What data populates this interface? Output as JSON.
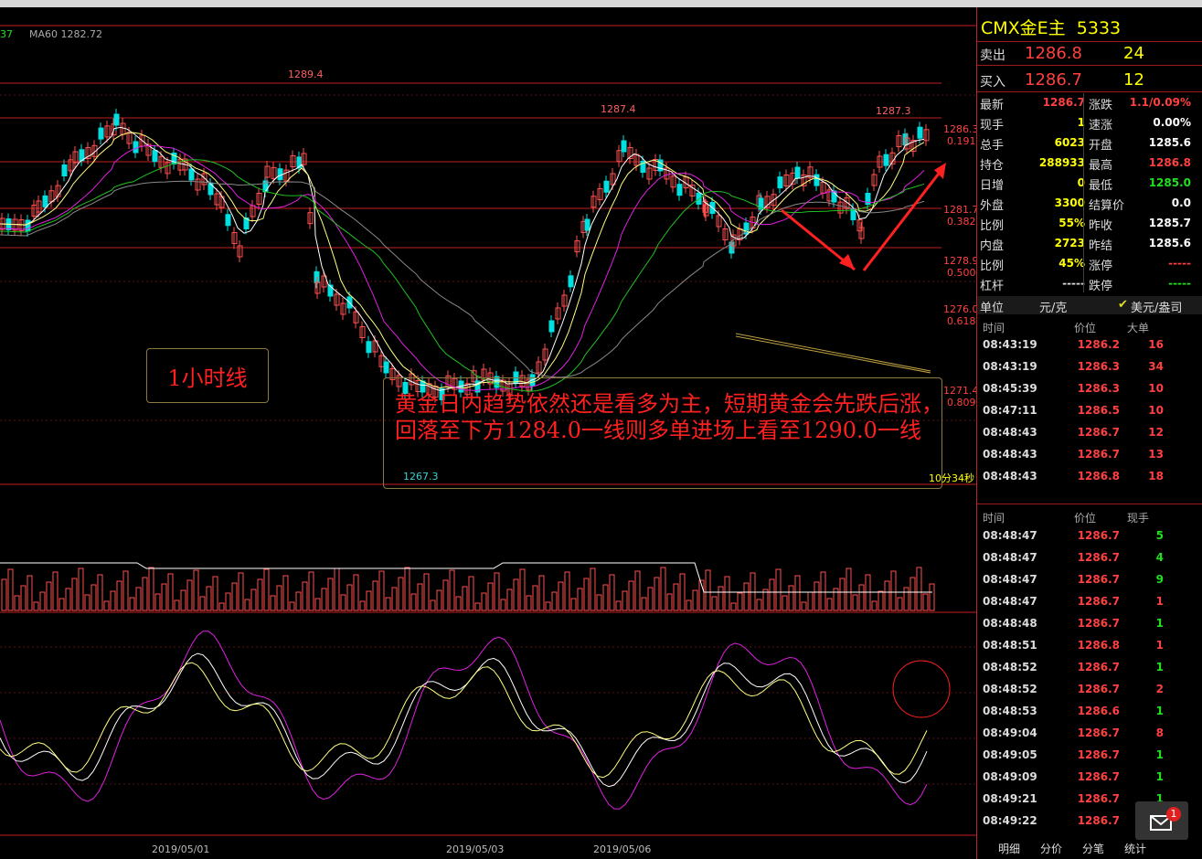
{
  "chart": {
    "ma_partial": "37",
    "ma60_label": "MA60 1282.72",
    "high_label_1": "1289.4",
    "high_label_2": "1287.4",
    "high_label_3": "1287.3",
    "low_label": "1267.3",
    "timer": "10分34秒",
    "hour_label": "1小时线",
    "annotation": "黄金日内趋势依然还是看多为主，短期黄金会先跌后涨，回落至下方1284.0一线则多单进场上看至1290.0一线",
    "fib_levels": [
      {
        "price": "1286.3",
        "ratio": "0.191"
      },
      {
        "price": "1281.7",
        "ratio": "0.382"
      },
      {
        "price": "1278.9",
        "ratio": "0.500"
      },
      {
        "price": "1276.0",
        "ratio": "0.618"
      },
      {
        "price": "1271.4",
        "ratio": "0.809"
      }
    ],
    "dates": [
      "2019/05/01",
      "2019/05/03",
      "2019/05/06"
    ]
  },
  "panel": {
    "title": "CMX金E主",
    "code": "5333",
    "sell": {
      "label": "卖出",
      "price": "1286.8",
      "qty": "24"
    },
    "buy": {
      "label": "买入",
      "price": "1286.7",
      "qty": "12"
    },
    "quote_left": [
      {
        "label": "最新",
        "value": "1286.7",
        "color": "#ff4040"
      },
      {
        "label": "现手",
        "value": "1",
        "color": "#ffff00"
      },
      {
        "label": "总手",
        "value": "6023",
        "color": "#ffff00"
      },
      {
        "label": "持仓",
        "value": "288933",
        "color": "#ffff00"
      },
      {
        "label": "日增",
        "value": "0",
        "color": "#ffff00"
      },
      {
        "label": "外盘",
        "value": "3300",
        "color": "#ffff00"
      },
      {
        "label": "比例",
        "value": "55%",
        "color": "#ffff00"
      },
      {
        "label": "内盘",
        "value": "2723",
        "color": "#ffff00"
      },
      {
        "label": "比例",
        "value": "45%",
        "color": "#ffff00"
      },
      {
        "label": "杠杆",
        "value": "-----",
        "color": "#dddddd"
      }
    ],
    "quote_right": [
      {
        "label": "涨跌",
        "value": "1.1/0.09%",
        "color": "#ff4040"
      },
      {
        "label": "速涨",
        "value": "0.00%",
        "color": "#ffffff"
      },
      {
        "label": "开盘",
        "value": "1285.6",
        "color": "#ffffff"
      },
      {
        "label": "最高",
        "value": "1286.8",
        "color": "#ff4040"
      },
      {
        "label": "最低",
        "value": "1285.0",
        "color": "#20e020"
      },
      {
        "label": "结算价",
        "value": "0.0",
        "color": "#ffffff"
      },
      {
        "label": "昨收",
        "value": "1285.7",
        "color": "#ffffff"
      },
      {
        "label": "昨结",
        "value": "1285.6",
        "color": "#ffffff"
      },
      {
        "label": "涨停",
        "value": "-----",
        "color": "#ff4040"
      },
      {
        "label": "跌停",
        "value": "-----",
        "color": "#20e020"
      }
    ],
    "unit_label": "单位",
    "unit_value": "元/克",
    "unit_check": "✔",
    "unit_alt": "美元/盎司",
    "big_orders_head": {
      "time": "时间",
      "price": "价位",
      "vol": "大单"
    },
    "big_orders": [
      {
        "time": "08:43:19",
        "price": "1286.2",
        "vol": "16"
      },
      {
        "time": "08:43:19",
        "price": "1286.3",
        "vol": "34"
      },
      {
        "time": "08:45:39",
        "price": "1286.3",
        "vol": "10"
      },
      {
        "time": "08:47:11",
        "price": "1286.5",
        "vol": "10"
      },
      {
        "time": "08:48:43",
        "price": "1286.7",
        "vol": "12"
      },
      {
        "time": "08:48:43",
        "price": "1286.7",
        "vol": "13"
      },
      {
        "time": "08:48:43",
        "price": "1286.8",
        "vol": "18"
      }
    ],
    "ticks_head": {
      "time": "时间",
      "price": "价位",
      "vol": "现手"
    },
    "ticks": [
      {
        "time": "08:48:47",
        "price": "1286.7",
        "vol": "5",
        "color": "#20e020"
      },
      {
        "time": "08:48:47",
        "price": "1286.7",
        "vol": "4",
        "color": "#20e020"
      },
      {
        "time": "08:48:47",
        "price": "1286.7",
        "vol": "9",
        "color": "#20e020"
      },
      {
        "time": "08:48:47",
        "price": "1286.7",
        "vol": "1",
        "color": "#ff4040"
      },
      {
        "time": "08:48:48",
        "price": "1286.7",
        "vol": "1",
        "color": "#20e020"
      },
      {
        "time": "08:48:51",
        "price": "1286.8",
        "vol": "1",
        "color": "#ff4040"
      },
      {
        "time": "08:48:52",
        "price": "1286.7",
        "vol": "1",
        "color": "#20e020"
      },
      {
        "time": "08:48:52",
        "price": "1286.7",
        "vol": "2",
        "color": "#ff4040"
      },
      {
        "time": "08:48:53",
        "price": "1286.6",
        "vol": "1",
        "color": "#20e020"
      },
      {
        "time": "08:49:04",
        "price": "1286.7",
        "vol": "8",
        "color": "#ff4040"
      },
      {
        "time": "08:49:05",
        "price": "1286.7",
        "vol": "1",
        "color": "#20e020"
      },
      {
        "time": "08:49:09",
        "price": "1286.7",
        "vol": "1",
        "color": "#20e020"
      },
      {
        "time": "08:49:21",
        "price": "1286.7",
        "vol": "1",
        "color": "#20e020"
      },
      {
        "time": "08:49:22",
        "price": "1286.7",
        "vol": "1",
        "color": "#20e020"
      }
    ],
    "tabs": [
      "明细",
      "分价",
      "分笔",
      "统计"
    ],
    "msg_badge": "1"
  }
}
